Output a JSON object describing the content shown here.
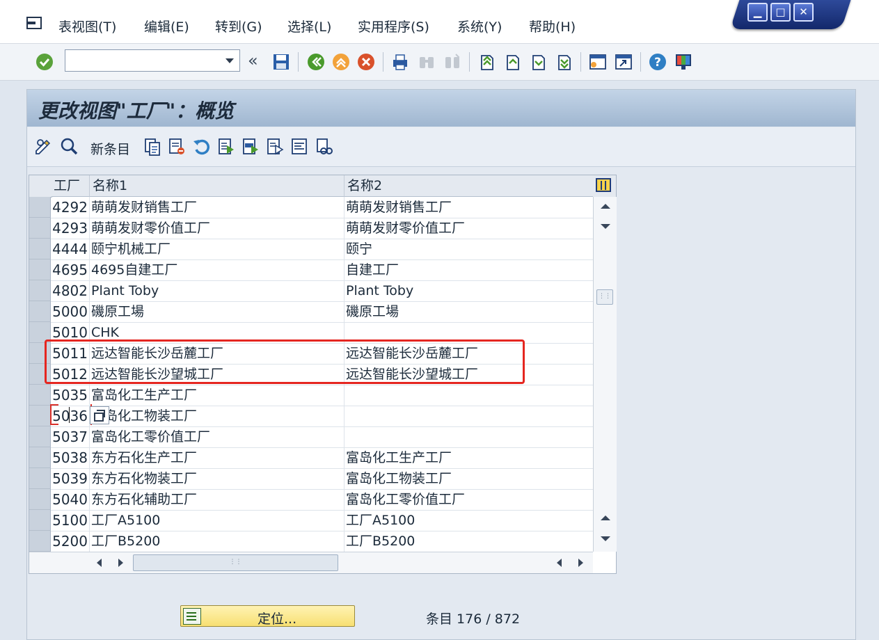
{
  "menu": {
    "items": [
      "表视图(T)",
      "编辑(E)",
      "转到(G)",
      "选择(L)",
      "实用程序(S)",
      "系统(Y)",
      "帮助(H)"
    ]
  },
  "window_controls": {
    "minimize": "▁",
    "maximize": "□",
    "close": "✕"
  },
  "toolbar": {
    "command_field_value": "",
    "back_glyph": "«"
  },
  "screen": {
    "title": "更改视图\"工厂\"：概览"
  },
  "subtoolbar": {
    "new_entries_label": "新条目"
  },
  "table": {
    "columns": [
      "工厂",
      "名称1",
      "名称2"
    ],
    "rows": [
      {
        "plant": "4292",
        "name1": "萌萌发财销售工厂",
        "name2": "萌萌发财销售工厂"
      },
      {
        "plant": "4293",
        "name1": "萌萌发财零价值工厂",
        "name2": "萌萌发财零价值工厂"
      },
      {
        "plant": "4444",
        "name1": "颐宁机械工厂",
        "name2": "颐宁"
      },
      {
        "plant": "4695",
        "name1": "4695自建工厂",
        "name2": "自建工厂"
      },
      {
        "plant": "4802",
        "name1": "Plant Toby",
        "name2": "Plant Toby"
      },
      {
        "plant": "5000",
        "name1": "磯原工場",
        "name2": "磯原工場"
      },
      {
        "plant": "5010",
        "name1": "CHK",
        "name2": ""
      },
      {
        "plant": "5011",
        "name1": "远达智能长沙岳麓工厂",
        "name2": "远达智能长沙岳麓工厂"
      },
      {
        "plant": "5012",
        "name1": "远达智能长沙望城工厂",
        "name2": "远达智能长沙望城工厂"
      },
      {
        "plant": "5035",
        "name1": "富岛化工生产工厂",
        "name2": ""
      },
      {
        "plant": "5036",
        "name1": "富岛化工物装工厂",
        "name2": ""
      },
      {
        "plant": "5037",
        "name1": "富岛化工零价值工厂",
        "name2": ""
      },
      {
        "plant": "5038",
        "name1": "东方石化生产工厂",
        "name2": "富岛化工生产工厂"
      },
      {
        "plant": "5039",
        "name1": "东方石化物装工厂",
        "name2": "富岛化工物装工厂"
      },
      {
        "plant": "5040",
        "name1": "东方石化辅助工厂",
        "name2": "富岛化工零价值工厂"
      },
      {
        "plant": "5100",
        "name1": "工厂A5100",
        "name2": "工厂A5100"
      },
      {
        "plant": "5200",
        "name1": "工厂B5200",
        "name2": "工厂B5200"
      }
    ],
    "highlighted_rows": [
      "5011",
      "5012"
    ],
    "focused_cell": "5036"
  },
  "footer": {
    "position_button_label": "定位...",
    "entries_text": "条目 176 / 872"
  },
  "colors": {
    "highlight_box": "#e52620",
    "position_button": "#f7df72",
    "title_bar": "#9fb6d0"
  }
}
